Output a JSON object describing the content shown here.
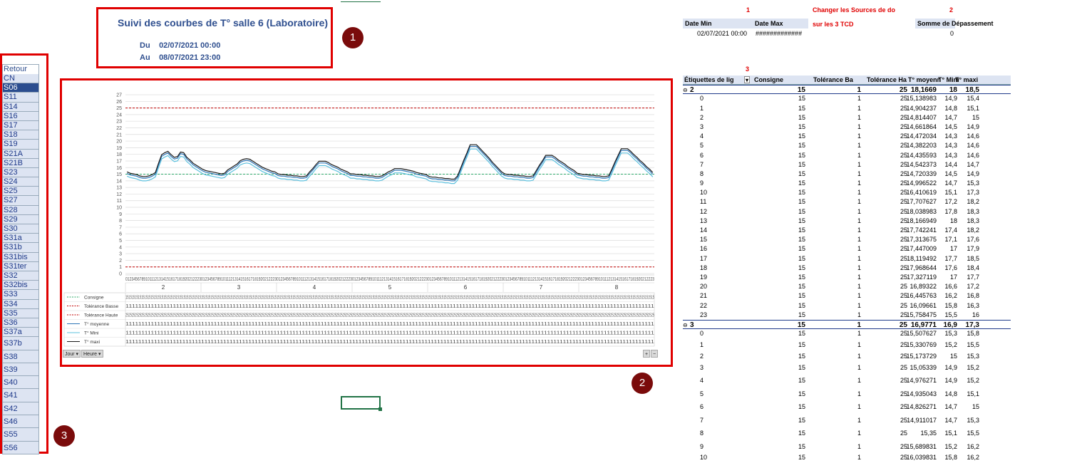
{
  "title": "Suivi des courbes de T° salle 6 (Laboratoire)",
  "date_from_label": "Du",
  "date_from": "02/07/2021 00:00",
  "date_to_label": "Au",
  "date_to": "08/07/2021 23:00",
  "badges": [
    "1",
    "2",
    "3"
  ],
  "slicer": {
    "header": "Retour",
    "items": [
      "CN",
      "S06",
      "S11",
      "S14",
      "S16",
      "S17",
      "S18",
      "S19",
      "S21A",
      "S21B",
      "S23",
      "S24",
      "S25",
      "S27",
      "S28",
      "S29",
      "S30",
      "S31a",
      "S31b",
      "S31bis",
      "S31ter",
      "S32",
      "S32bis",
      "S33",
      "S34",
      "S35",
      "S36",
      "S37a",
      "S37b",
      "S38",
      "S39",
      "S40",
      "S41",
      "S42",
      "S46",
      "S55",
      "S56"
    ],
    "selected": "S06"
  },
  "top_right": {
    "red_num_1": "1",
    "red_num_2": "2",
    "red_num_3": "3",
    "change_sources_line1": "Changer les Sources de do",
    "change_sources_line2": "sur les 3 TCD",
    "date_min_label": "Date Min",
    "date_max_label": "Date Max",
    "date_min_value": "02/07/2021 00:00",
    "date_max_value": "#############",
    "sum_label": "Somme de Dépassement",
    "sum_value": "0"
  },
  "pivot": {
    "headers": [
      "Étiquettes de lig",
      "Consigne",
      "Tolérance Ba",
      "Tolérance Ha",
      "T° moyenn",
      "T° Mini",
      "T° maxi"
    ],
    "rows": [
      {
        "type": "group",
        "label": "2",
        "c": "15",
        "tb": "1",
        "th": "25",
        "avg": "18,1669",
        "min": "18",
        "max": "18,5"
      },
      {
        "label": "0",
        "c": "15",
        "tb": "1",
        "th": "25",
        "avg": "15,138983",
        "min": "14,9",
        "max": "15,4"
      },
      {
        "label": "1",
        "c": "15",
        "tb": "1",
        "th": "25",
        "avg": "14,904237",
        "min": "14,8",
        "max": "15,1"
      },
      {
        "label": "2",
        "c": "15",
        "tb": "1",
        "th": "25",
        "avg": "14,814407",
        "min": "14,7",
        "max": "15"
      },
      {
        "label": "3",
        "c": "15",
        "tb": "1",
        "th": "25",
        "avg": "14,661864",
        "min": "14,5",
        "max": "14,9"
      },
      {
        "label": "4",
        "c": "15",
        "tb": "1",
        "th": "25",
        "avg": "14,472034",
        "min": "14,3",
        "max": "14,6"
      },
      {
        "label": "5",
        "c": "15",
        "tb": "1",
        "th": "25",
        "avg": "14,382203",
        "min": "14,3",
        "max": "14,6"
      },
      {
        "label": "6",
        "c": "15",
        "tb": "1",
        "th": "25",
        "avg": "14,435593",
        "min": "14,3",
        "max": "14,6"
      },
      {
        "label": "7",
        "c": "15",
        "tb": "1",
        "th": "25",
        "avg": "14,542373",
        "min": "14,4",
        "max": "14,7"
      },
      {
        "label": "8",
        "c": "15",
        "tb": "1",
        "th": "25",
        "avg": "14,720339",
        "min": "14,5",
        "max": "14,9"
      },
      {
        "label": "9",
        "c": "15",
        "tb": "1",
        "th": "25",
        "avg": "14,996522",
        "min": "14,7",
        "max": "15,3"
      },
      {
        "label": "10",
        "c": "15",
        "tb": "1",
        "th": "25",
        "avg": "16,410619",
        "min": "15,1",
        "max": "17,3"
      },
      {
        "label": "11",
        "c": "15",
        "tb": "1",
        "th": "25",
        "avg": "17,707627",
        "min": "17,2",
        "max": "18,2"
      },
      {
        "label": "12",
        "c": "15",
        "tb": "1",
        "th": "25",
        "avg": "18,038983",
        "min": "17,8",
        "max": "18,3"
      },
      {
        "label": "13",
        "c": "15",
        "tb": "1",
        "th": "25",
        "avg": "18,166949",
        "min": "18",
        "max": "18,3"
      },
      {
        "label": "14",
        "c": "15",
        "tb": "1",
        "th": "25",
        "avg": "17,742241",
        "min": "17,4",
        "max": "18,2"
      },
      {
        "label": "15",
        "c": "15",
        "tb": "1",
        "th": "25",
        "avg": "17,313675",
        "min": "17,1",
        "max": "17,6"
      },
      {
        "label": "16",
        "c": "15",
        "tb": "1",
        "th": "25",
        "avg": "17,447009",
        "min": "17",
        "max": "17,9"
      },
      {
        "label": "17",
        "c": "15",
        "tb": "1",
        "th": "25",
        "avg": "18,119492",
        "min": "17,7",
        "max": "18,5"
      },
      {
        "label": "18",
        "c": "15",
        "tb": "1",
        "th": "25",
        "avg": "17,968644",
        "min": "17,6",
        "max": "18,4"
      },
      {
        "label": "19",
        "c": "15",
        "tb": "1",
        "th": "25",
        "avg": "17,327119",
        "min": "17",
        "max": "17,7"
      },
      {
        "label": "20",
        "c": "15",
        "tb": "1",
        "th": "25",
        "avg": "16,89322",
        "min": "16,6",
        "max": "17,2"
      },
      {
        "label": "21",
        "c": "15",
        "tb": "1",
        "th": "25",
        "avg": "16,445763",
        "min": "16,2",
        "max": "16,8"
      },
      {
        "label": "22",
        "c": "15",
        "tb": "1",
        "th": "25",
        "avg": "16,09661",
        "min": "15,8",
        "max": "16,3"
      },
      {
        "label": "23",
        "c": "15",
        "tb": "1",
        "th": "25",
        "avg": "15,758475",
        "min": "15,5",
        "max": "16"
      },
      {
        "type": "group",
        "label": "3",
        "c": "15",
        "tb": "1",
        "th": "25",
        "avg": "16,9771",
        "min": "16,9",
        "max": "17,3"
      },
      {
        "label": "0",
        "c": "15",
        "tb": "1",
        "th": "25",
        "avg": "15,507627",
        "min": "15,3",
        "max": "15,8"
      },
      {
        "label": "1",
        "c": "15",
        "tb": "1",
        "th": "25",
        "avg": "15,330769",
        "min": "15,2",
        "max": "15,5",
        "big": true
      },
      {
        "label": "2",
        "c": "15",
        "tb": "1",
        "th": "25",
        "avg": "15,173729",
        "min": "15",
        "max": "15,3"
      },
      {
        "label": "3",
        "c": "15",
        "tb": "1",
        "th": "25",
        "avg": "15,05339",
        "min": "14,9",
        "max": "15,2",
        "big": true
      },
      {
        "label": "4",
        "c": "15",
        "tb": "1",
        "th": "25",
        "avg": "14,976271",
        "min": "14,9",
        "max": "15,2",
        "big": true
      },
      {
        "label": "5",
        "c": "15",
        "tb": "1",
        "th": "25",
        "avg": "14,935043",
        "min": "14,8",
        "max": "15,1",
        "big": true
      },
      {
        "label": "6",
        "c": "15",
        "tb": "1",
        "th": "25",
        "avg": "14,826271",
        "min": "14,7",
        "max": "15",
        "big": true
      },
      {
        "label": "7",
        "c": "15",
        "tb": "1",
        "th": "25",
        "avg": "14,911017",
        "min": "14,7",
        "max": "15,3",
        "big": true
      },
      {
        "label": "8",
        "c": "15",
        "tb": "1",
        "th": "25",
        "avg": "15,35",
        "min": "15,1",
        "max": "15,5",
        "big": true
      },
      {
        "label": "9",
        "c": "15",
        "tb": "1",
        "th": "25",
        "avg": "15,689831",
        "min": "15,2",
        "max": "16,2",
        "big": true
      },
      {
        "label": "10",
        "c": "15",
        "tb": "1",
        "th": "25",
        "avg": "16,039831",
        "min": "15,8",
        "max": "16,2"
      }
    ]
  },
  "chart_data": {
    "type": "line",
    "y_ticks": [
      "0",
      "1",
      "2",
      "3",
      "4",
      "5",
      "6",
      "7",
      "8",
      "9",
      "10",
      "11",
      "12",
      "13",
      "14",
      "15",
      "16",
      "17",
      "18",
      "19",
      "20",
      "21",
      "22",
      "23",
      "24",
      "25",
      "26",
      "27"
    ],
    "ylim": [
      0,
      27
    ],
    "x_day_labels": [
      "2",
      "3",
      "4",
      "5",
      "6",
      "7",
      "8"
    ],
    "hours_per_day": 24,
    "legend": [
      "Consigne",
      "Tolérance Basse",
      "Tolérance Haute",
      "T° moyenne",
      "T° Mini",
      "T° maxi"
    ],
    "field_buttons": [
      "Jour",
      "Heure"
    ],
    "series": [
      {
        "name": "Consigne",
        "color": "#2eaa6a",
        "dash": true,
        "constant": 15
      },
      {
        "name": "Tolérance Basse",
        "color": "#c00000",
        "dash": true,
        "constant": 1
      },
      {
        "name": "Tolérance Haute",
        "color": "#c00000",
        "dash": true,
        "constant": 25
      },
      {
        "name": "T° moyenne",
        "color": "#2e75b6",
        "values": [
          15.1,
          14.9,
          14.8,
          14.7,
          14.5,
          14.4,
          14.4,
          14.5,
          14.7,
          15,
          16.4,
          17.7,
          18,
          18.2,
          17.7,
          17.3,
          17.4,
          18.1,
          18,
          17.3,
          16.9,
          16.4,
          16.1,
          15.8,
          15.5,
          15.3,
          15.2,
          15.1,
          15,
          14.9,
          14.8,
          14.9,
          15.4,
          15.7,
          16,
          16.3,
          16.8,
          17,
          17.1,
          17,
          16.7,
          16.4,
          16.1,
          15.8,
          15.6,
          15.4,
          15.2,
          15.1
        ]
      },
      {
        "name": "T° Mini",
        "color": "#5bc0de"
      },
      {
        "name": "T° maxi",
        "color": "#1a1a1a"
      }
    ]
  }
}
